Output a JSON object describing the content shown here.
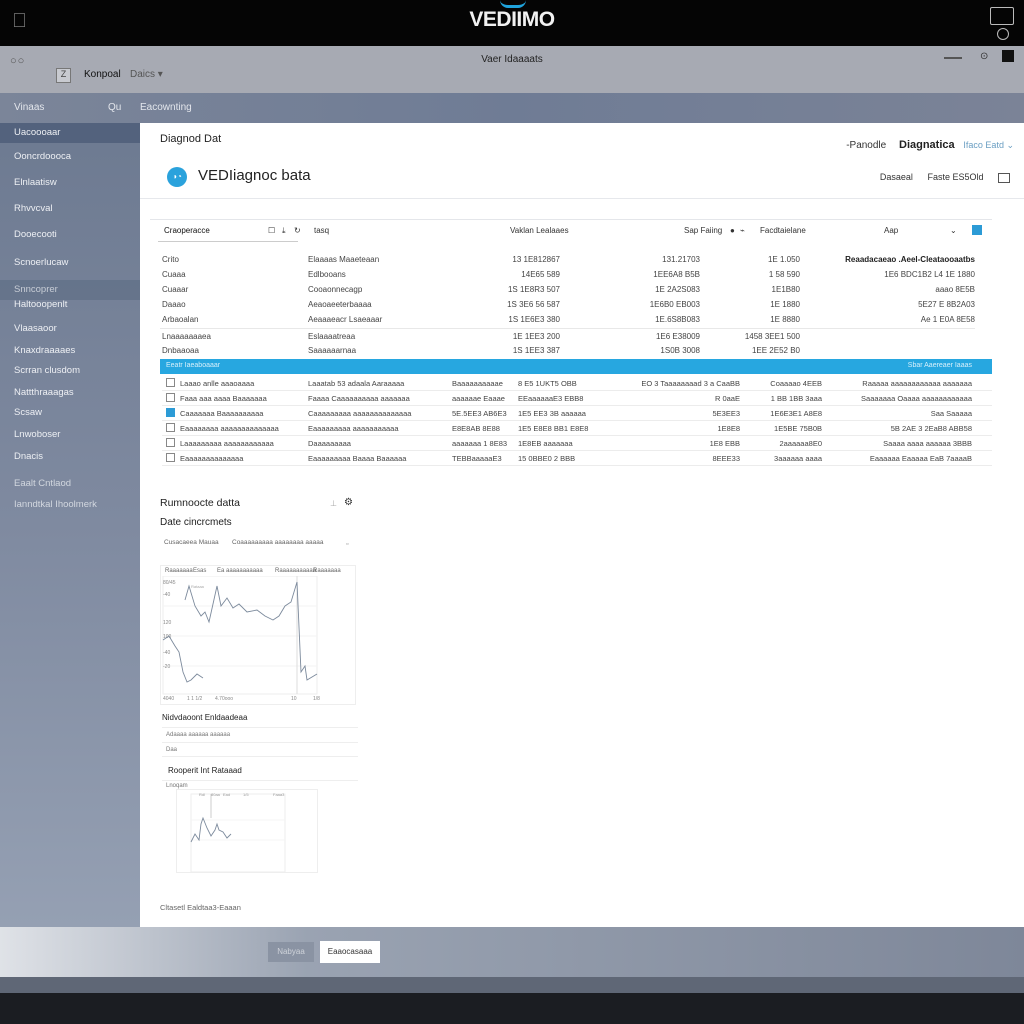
{
  "system_bar": {
    "brand": "VEDIIMO"
  },
  "window": {
    "title": "Vaer Idaaaats",
    "app_name": "Konpoal",
    "device_menu": "Daics",
    "nav": {
      "left": "Vinaas",
      "center_icon": "Qu",
      "item": "Eacownting"
    }
  },
  "sidebar": {
    "items": [
      {
        "label": "Uacoooaar",
        "active": true
      },
      {
        "label": "Ooncrdoooca"
      },
      {
        "label": "Elnlaatisw"
      },
      {
        "label": "Rhvvcval"
      },
      {
        "label": "Dooecooti"
      },
      {
        "label": "Scnoerlucaw"
      },
      {
        "label": "Snncoprer",
        "separator": true
      },
      {
        "label": "Haltooopenlt"
      },
      {
        "label": "Vlaasaoor"
      },
      {
        "label": "Knaxdraaaaes"
      },
      {
        "label": "Scrran clusdom"
      },
      {
        "label": "Nattthraaagas"
      },
      {
        "label": "Scsaw"
      },
      {
        "label": "Lnwoboser"
      },
      {
        "label": "Dnacis"
      },
      {
        "label": "Eaalt Cntlaod",
        "dim": true
      },
      {
        "label": "Ianndtkal Ihoolmerk",
        "dim": true
      }
    ]
  },
  "main": {
    "breadcrumb": "Diagnod Dat",
    "header_links": {
      "link1": "-Panodle",
      "link2": "Diagnatica",
      "link3": "Ifaco Eatd"
    },
    "title": "VEDIiagnoc bata",
    "actions": {
      "a1": "Dasaeal",
      "a2": "Faste ES5Old"
    },
    "toolbar": {
      "search_value": "Craoperacce",
      "label1": "tasq",
      "col_header": "Vaklan Lealaaes",
      "sorting": "Sap Faiing",
      "label2": "Facdtaielane",
      "label3": "Aap"
    },
    "rows": [
      {
        "c1": "Crito",
        "c2": "Elaaaas Maaeteaan",
        "c3": "13 1E812867",
        "c4": "131.21703",
        "c5": "1E 1.050",
        "c6": "Reaadacaeao .Aeel-Cleataooaatbs"
      },
      {
        "c1": "Cuaaa",
        "c2": "Edlbooans",
        "c3": "14E65 589",
        "c4": "1EE6A8 B5B",
        "c5": "1 58 590",
        "c6": "1E6 BDC1B2 L4 1E 1880"
      },
      {
        "c1": "Cuaaar",
        "c2": "Cooaonnecagp",
        "c3": "1S 1E8R3 507",
        "c4": "1E 2A2S083",
        "c5": "1E1B80",
        "c6": "aaao 8E5B"
      },
      {
        "c1": "Daaao",
        "c2": "Aeaoaeeterbaaaa",
        "c3": "1S 3E6 56 587",
        "c4": "1E6B0 EB003",
        "c5": "1E 1880",
        "c6": "5E27 E 8B2A03"
      },
      {
        "c1": "Arbaoalan",
        "c2": "Aeaaaeacr Lsaeaaar",
        "c3": "1S 1E6E3 380",
        "c4": "1E.6S8B083",
        "c5": "1E 8880",
        "c6": "Ae 1 E0A 8E58"
      },
      {
        "c1": "Lnaaaaaaaea",
        "c2": "Eslaaaatreaa",
        "c3": "1E 1EE3 200",
        "c4": "1E6 E38009",
        "c5": "1458 3EE1 500",
        "c6": ""
      },
      {
        "c1": "Dnbaaoaa",
        "c2": "Saaaaaarnaa",
        "c3": "1S 1EE3 387",
        "c4": "1S0B 3008",
        "c5": "1EE 2E52 B0",
        "c6": ""
      }
    ],
    "section_bar": {
      "left": "Eeatr Iaeaboaaar",
      "right": "Sbar Aaereaer Iaaas"
    },
    "rows2": [
      {
        "checked": false,
        "c1": "Laaao anlle aaaoaaaa",
        "c2": "Laaatab 53 adaala Aaraaaaa",
        "c3": "Baaaaaaaaaae",
        "c4": "8 E5 1UKT5 OBB",
        "c5": "EO 3 Taaaaaaaad 3 a CaaBB",
        "c6": "Coaaaao 4EEB",
        "c7": "Raaaaa aaaaaaaaaaaa aaaaaaa"
      },
      {
        "checked": false,
        "c1": "Faaa aaa aaaa Baaaaaaa",
        "c2": "Faaaa Caaaaaaaaaa aaaaaaa",
        "c3": "aaaaaae Eaaae",
        "c4": "EEaaaaaaE3 EBB8",
        "c5": "R 0aaE",
        "c6": "1 BB 1BB 3aaa",
        "c7": "Saaaaaaa Oaaaa aaaaaaaaaaaa"
      },
      {
        "checked": true,
        "c1": "Caaaaaaa Baaaaaaaaaa",
        "c2": "Caaaaaaaaa aaaaaaaaaaaaaa",
        "c3": "5E.5EE3 AB6E3",
        "c4": "1E5 EE3 3B aaaaaa",
        "c5": "5E3EE3",
        "c6": "1E6E3E1 A8E8",
        "c7": "Saa Saaaaa"
      },
      {
        "checked": false,
        "c1": "Eaaaaaaaa aaaaaaaaaaaaaa",
        "c2": "Eaaaaaaaaa aaaaaaaaaaa",
        "c3": "E8E8AB 8E88",
        "c4": "1E5 E8E8 BB1 E8E8",
        "c5": "1E8E8",
        "c6": "1E5BE 75B0B",
        "c7": "5B 2AE 3 2EaB8 ABB58"
      },
      {
        "checked": false,
        "c1": "Laaaaaaaaa aaaaaaaaaaaa",
        "c2": "Daaaaaaaaa",
        "c3": "aaaaaaa 1 8E83",
        "c4": "1E8EB aaaaaaa",
        "c5": "1E8 EBB",
        "c6": "2aaaaaa8E0",
        "c7": "Saaaa aaaa aaaaaa 3BBB"
      },
      {
        "checked": false,
        "c1": "Eaaaaaaaaaaaaaa",
        "c2": "Eaaaaaaaaa Baaaa Baaaaaa",
        "c3": "TEBBaaaaaE3",
        "c4": "15 0BBE0 2 BBB",
        "c5": "8EEE33",
        "c6": "3aaaaaa aaaa",
        "c7": "Eaaaaaa Eaaaaa EaB 7aaaaB"
      }
    ],
    "diag": {
      "title": "Rumnoocte datta",
      "subtitle": "Date cincrcmets",
      "filter1": "Cusacaeea Mauaa",
      "filter2": "Coaaaaaaaaa aaaaaaaa aaaaa",
      "chart_tabs": [
        "Raaaaaaa",
        "Esas",
        "Ea aaaaaaaaaaa",
        "Raaaaaaaaaaa",
        "Raaaaaaa"
      ],
      "y_ticks": [
        "80/45",
        "-40",
        "120",
        "100",
        "-40",
        "-20"
      ],
      "x_ticks": [
        "4040",
        "1 1 1/2",
        "4.70ooo",
        "10",
        "1/8"
      ],
      "series_label": "Rataaa"
    },
    "sec2_title": "Nidvdaoont Enldaadeaa",
    "sec2_rows": [
      "Adaaaa aaaaaa aaaaaa",
      "Daa"
    ],
    "sec3_title": "Rooperit Int Rataaad",
    "sec3_label": "Lnoqam",
    "sec3_ticks": [
      "Rdl",
      "80aa",
      "Ead",
      "1/5",
      "Faaa3"
    ],
    "footer_note": "Cltasetl Ealdtaa3-Eaaan"
  },
  "footer": {
    "cancel": "Nabyaa",
    "ok": "Eaaocasaaa"
  }
}
